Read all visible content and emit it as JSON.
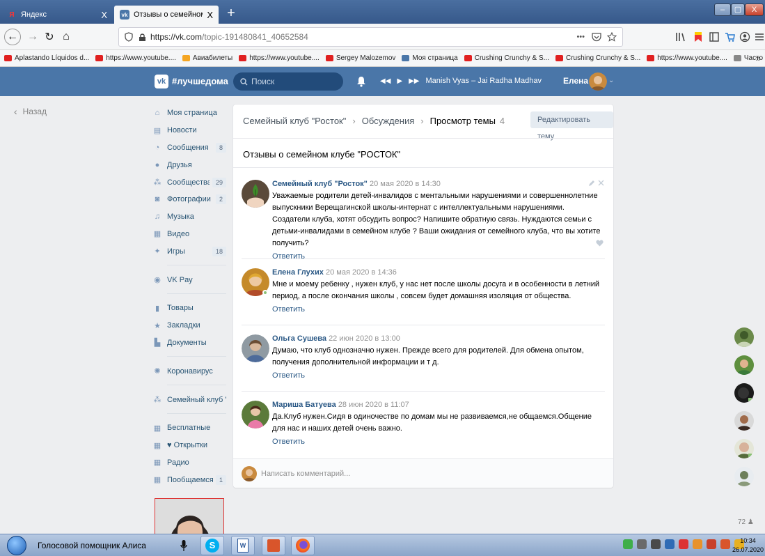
{
  "browser": {
    "tabs": [
      {
        "label": "Яндекс",
        "close": "X",
        "active": false
      },
      {
        "label": "Отзывы о семейном клубе \"Р",
        "close": "X",
        "active": true
      }
    ],
    "new_tab": "+",
    "window_buttons": {
      "minimize": "–",
      "maximize": "▢",
      "close": "X"
    },
    "url_host": "https://vk.com",
    "url_path": "/topic-191480841_40652584",
    "url_menu": "•••",
    "bookmarks": [
      {
        "label": "Aplastando Líquidos d...",
        "color": "#e02020"
      },
      {
        "label": "https://www.youtube....",
        "color": "#e02020"
      },
      {
        "label": "Авиабилеты",
        "color": "#f5a623"
      },
      {
        "label": "https://www.youtube....",
        "color": "#e02020"
      },
      {
        "label": "Sergey Malozemov",
        "color": "#e02020"
      },
      {
        "label": "Моя страница",
        "color": "#4a76a8"
      },
      {
        "label": "Crushing Crunchy & S...",
        "color": "#e02020"
      },
      {
        "label": "Crushing Crunchy & S...",
        "color": "#e02020"
      },
      {
        "label": "https://www.youtube....",
        "color": "#e02020"
      },
      {
        "label": "Часто посещаемые",
        "color": "#888888"
      }
    ],
    "bookmarks_overflow": "»"
  },
  "vk_header": {
    "logo": "vk",
    "brand": "#лучшедома",
    "search_placeholder": "Поиск",
    "now_playing": "Manish Vyas – Jai Radha Madhav",
    "user_name": "Елена",
    "caret": "⌄"
  },
  "back_label": "Назад",
  "left_menu": {
    "group1": [
      {
        "label": "Моя страница",
        "icon": "home-icon",
        "glyph": "⌂",
        "count": ""
      },
      {
        "label": "Новости",
        "icon": "news-icon",
        "glyph": "▤",
        "count": ""
      },
      {
        "label": "Сообщения",
        "icon": "messages-icon",
        "glyph": "◔",
        "count": "8"
      },
      {
        "label": "Друзья",
        "icon": "friends-icon",
        "glyph": "●",
        "count": ""
      },
      {
        "label": "Сообщества",
        "icon": "communities-icon",
        "glyph": "⁂",
        "count": "29"
      },
      {
        "label": "Фотографии",
        "icon": "photos-icon",
        "glyph": "◙",
        "count": "2"
      },
      {
        "label": "Музыка",
        "icon": "music-icon",
        "glyph": "♫",
        "count": ""
      },
      {
        "label": "Видео",
        "icon": "video-icon",
        "glyph": "▦",
        "count": ""
      },
      {
        "label": "Игры",
        "icon": "games-icon",
        "glyph": "✦",
        "count": "18"
      }
    ],
    "group2": [
      {
        "label": "VK Pay",
        "icon": "vkpay-icon",
        "glyph": "◉",
        "count": ""
      }
    ],
    "group3": [
      {
        "label": "Товары",
        "icon": "goods-icon",
        "glyph": "▮",
        "count": ""
      },
      {
        "label": "Закладки",
        "icon": "bookmarks-icon",
        "glyph": "★",
        "count": ""
      },
      {
        "label": "Документы",
        "icon": "documents-icon",
        "glyph": "▙",
        "count": ""
      }
    ],
    "group4": [
      {
        "label": "Коронавирус",
        "icon": "coronavirus-icon",
        "glyph": "✺",
        "count": ""
      }
    ],
    "group5": [
      {
        "label": "Семейный клуб \"...",
        "icon": "community-icon",
        "glyph": "⁂",
        "count": ""
      }
    ],
    "group6": [
      {
        "label": "Бесплатные",
        "icon": "app-icon",
        "glyph": "▦",
        "count": ""
      },
      {
        "label": "♥ Открытки",
        "icon": "app-icon",
        "glyph": "▦",
        "count": ""
      },
      {
        "label": "Радио",
        "icon": "app-icon",
        "glyph": "▦",
        "count": ""
      },
      {
        "label": "Пообщаемся?",
        "icon": "app-icon",
        "glyph": "▦",
        "count": "1"
      }
    ]
  },
  "topic": {
    "breadcrumb": {
      "club": "Семейный клуб \"Росток\"",
      "discussions": "Обсуждения",
      "current": "Просмотр темы",
      "count": "4",
      "separator": "›"
    },
    "edit_button": "Редактировать тему",
    "title": "Отзывы о семейном клубе \"РОСТОК\"",
    "reply_label": "Ответить",
    "comment_placeholder": "Написать комментарий...",
    "posts": [
      {
        "author": "Семейный клуб \"Росток\"",
        "date": "20 мая 2020 в 14:30",
        "text": "Уважаемые родители детей-инвалидов с ментальными нарушениями и совершеннолетние выпускники Верещагинской школы-интернат с интеллектуальными нарушениями. Создатели клуба, хотят обсудить вопрос? Напишите обратную связь. Нуждаются семьи с детьми-инвалидами в семейном клубе ? Ваши ожидания от семейного клуба, что вы хотите получить?"
      },
      {
        "author": "Елена Глухих",
        "date": "20 мая 2020 в 14:36",
        "text": "Мне и моему ребенку , нужен клуб, у нас нет после школы досуга и в особенности в летний период, а после окончания школы , совсем будет домашняя изоляция от общества."
      },
      {
        "author": "Ольга Сушева",
        "date": "22 июн 2020 в 13:00",
        "text": "Думаю, что клуб однозначно нужен. Прежде всего для родителей. Для обмена опытом, получения дополнительной информации и т д."
      },
      {
        "author": "Мариша Батуева",
        "date": "28 июн 2020 в 11:07",
        "text": "Да.Клуб нужен.Сидя в одиночестве по домам мы не развиваемся,не общаемся.Общение для нас и наших детей очень важно."
      }
    ]
  },
  "friends_online_count": "72",
  "taskbar": {
    "assistant_label": "Голосовой помощник Алиса",
    "time": "10:34",
    "date": "26.07.2020"
  },
  "colors": {
    "vk_blue": "#4a76a8",
    "link": "#2a5885",
    "online": "#8ac176"
  }
}
